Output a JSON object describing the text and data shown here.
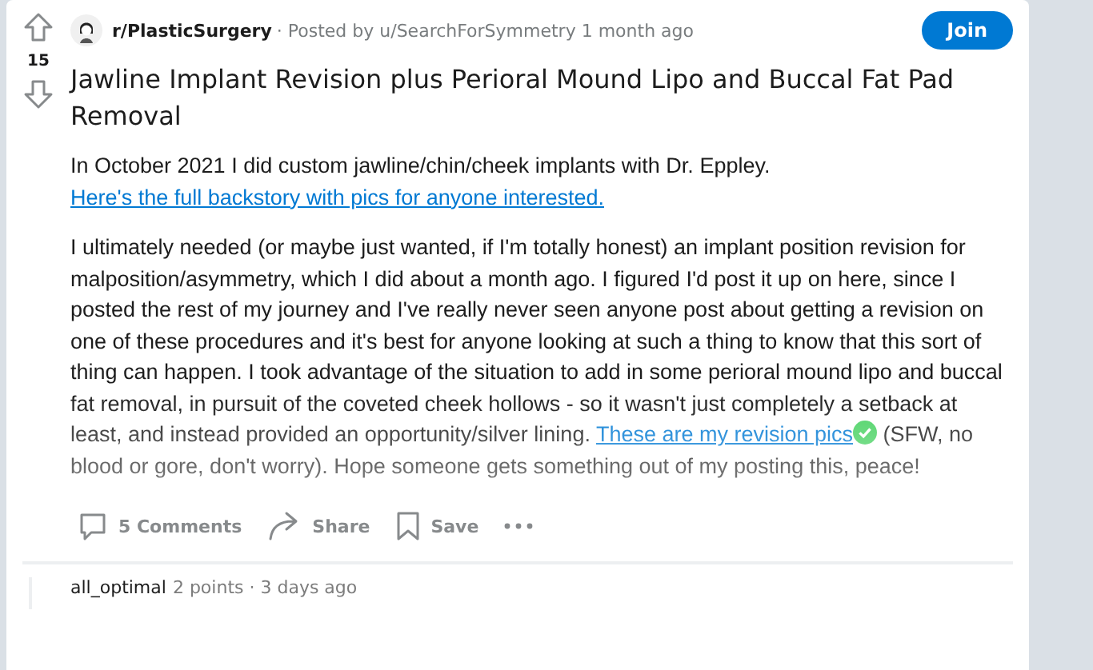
{
  "post": {
    "votes": "15",
    "subreddit": "r/PlasticSurgery",
    "posted_by": "· Posted by u/SearchForSymmetry 1 month ago",
    "join": "Join",
    "title": "Jawline Implant Revision plus Perioral Mound Lipo and Buccal Fat Pad Removal",
    "paragraphs": [
      {
        "text": "In October 2021 I did custom jawline/chin/cheek implants with Dr. Eppley.",
        "link": "Here's the full backstory with pics for anyone interested."
      },
      {
        "text": "I ultimately needed (or maybe just wanted, if I'm totally honest) an implant position revision for malposition/asymmetry, which I did about a month ago. I figured I'd post it up on here, since I posted the rest of my journey and I've really never seen anyone post about getting a revision on one of these procedures and it's best for anyone looking at such a thing to know that this sort of thing can happen. I took advantage of the situation to add in some perioral mound lipo and buccal fat removal, in pursuit of the coveted cheek hollows - so it wasn't just completely a setback at least, and instead provided an opportunity/silver lining.",
        "link": "These are my revision pics",
        "verified": true,
        "after": "(SFW, no blood or gore, don't worry). Hope someone gets something out of my posting this, peace!"
      }
    ],
    "actions": [
      {
        "kind": "comments",
        "label": "5 Comments"
      },
      {
        "kind": "share",
        "label": "Share"
      },
      {
        "kind": "save",
        "label": "Save"
      },
      {
        "kind": "more"
      }
    ]
  },
  "comment": {
    "author": "all_optimal",
    "meta": "2 points · 3 days ago"
  }
}
